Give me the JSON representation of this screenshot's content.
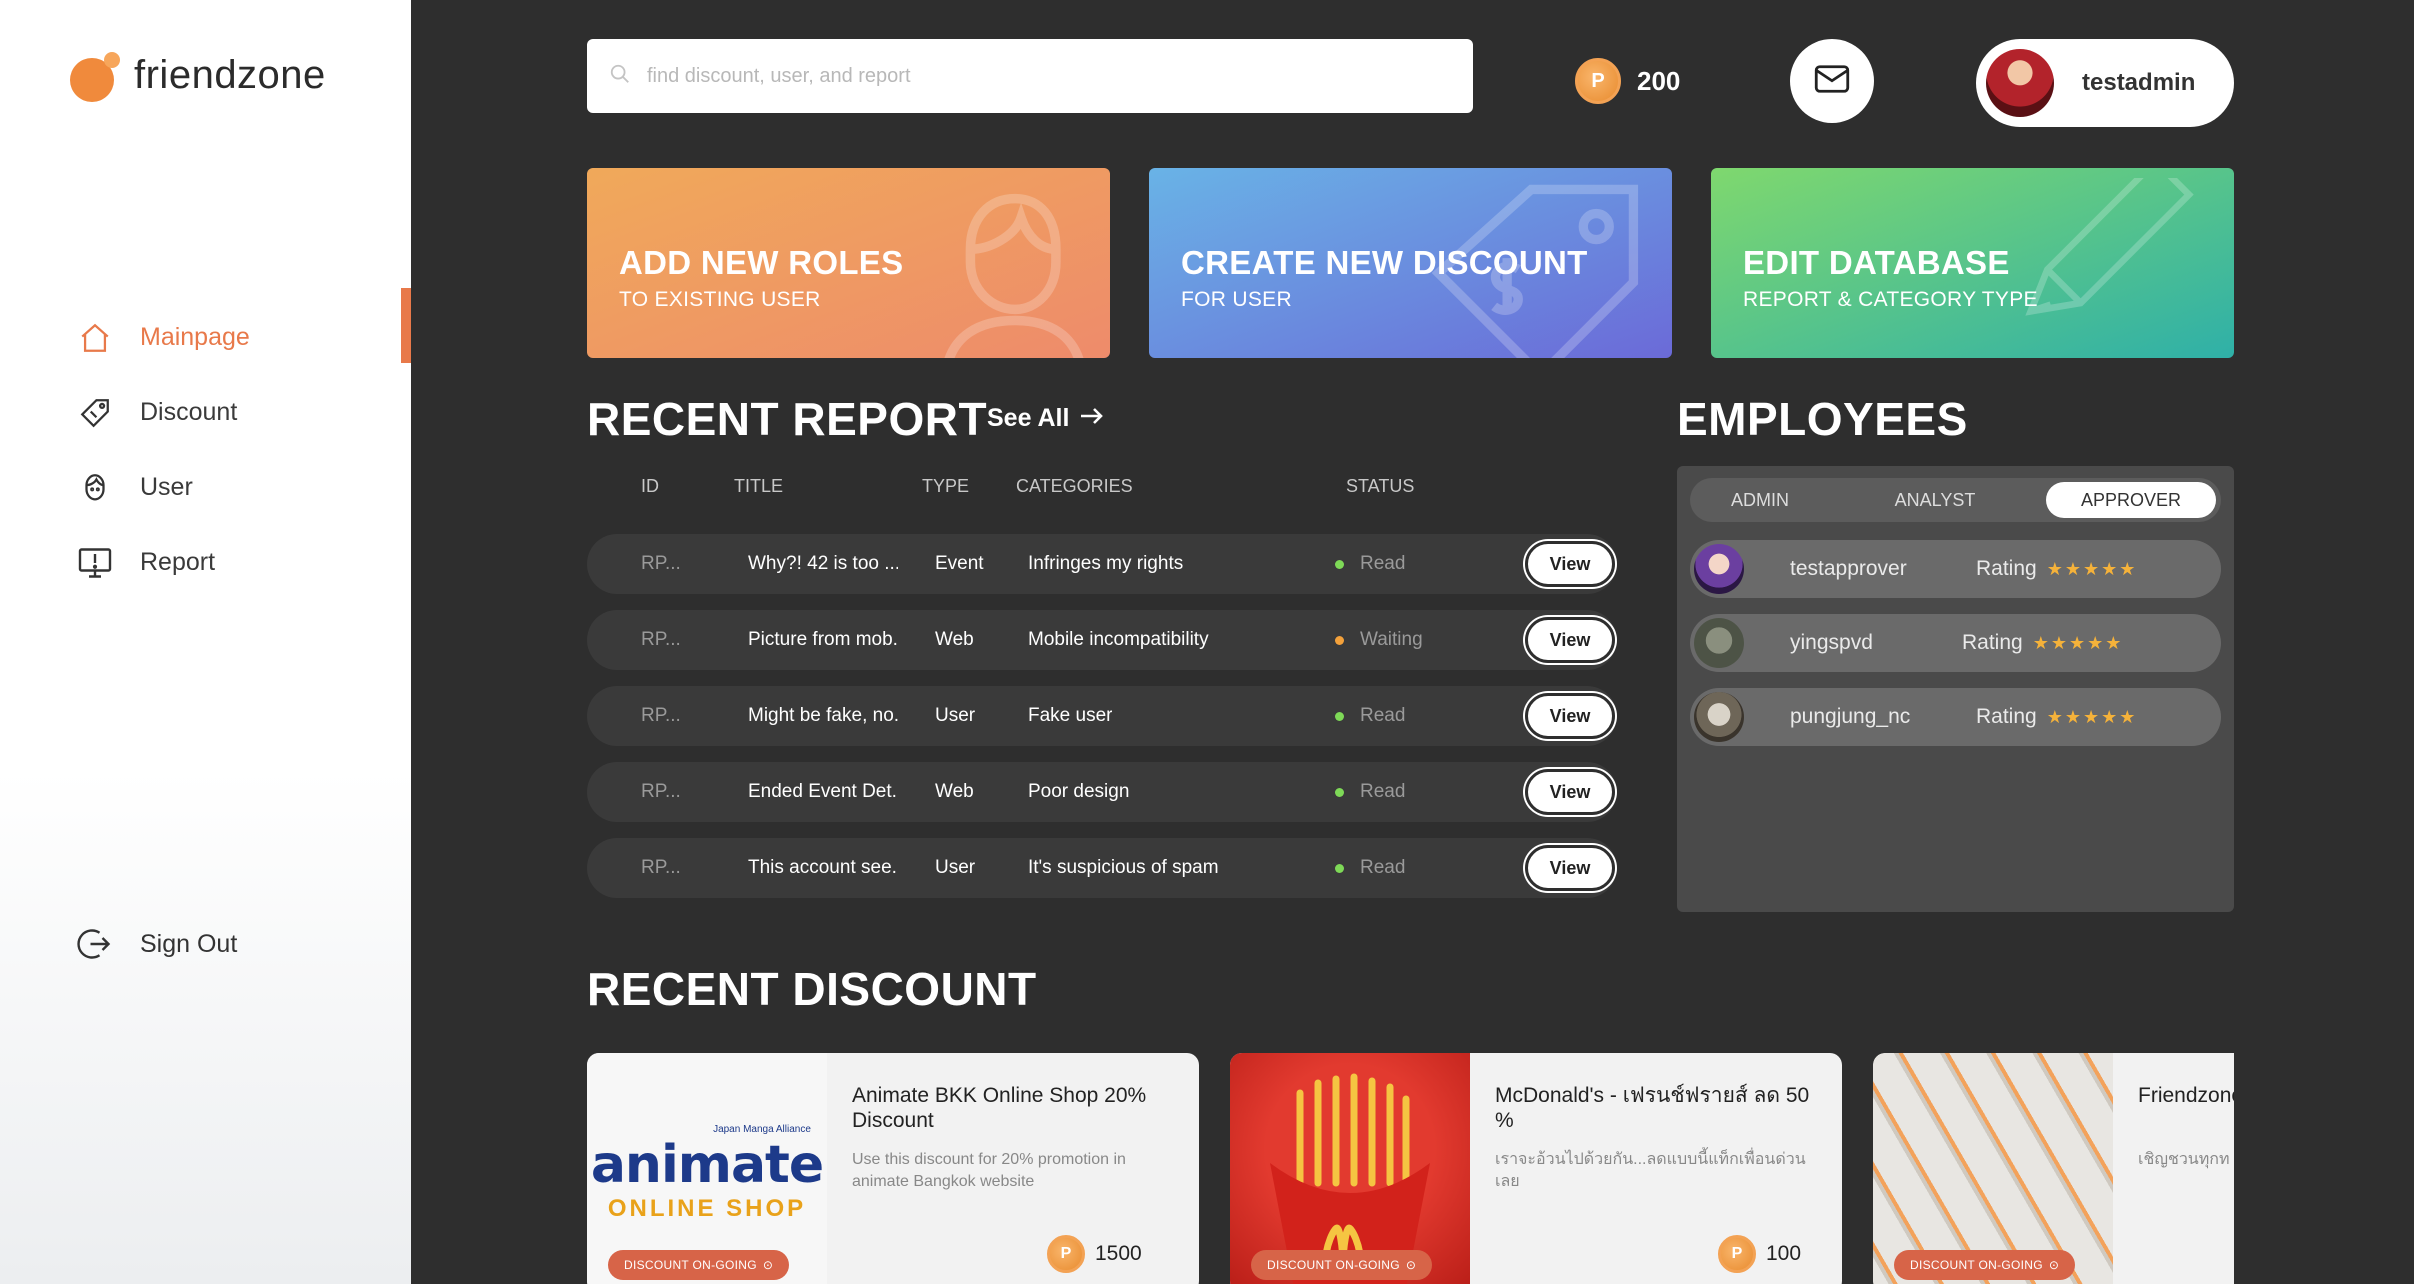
{
  "app": {
    "name": "friendzone"
  },
  "nav": {
    "items": [
      {
        "label": "Mainpage",
        "icon": "home-icon",
        "active": true
      },
      {
        "label": "Discount",
        "icon": "tag-icon",
        "active": false
      },
      {
        "label": "User",
        "icon": "user-icon",
        "active": false
      },
      {
        "label": "Report",
        "icon": "report-icon",
        "active": false
      }
    ],
    "sign_out": "Sign Out"
  },
  "search": {
    "placeholder": "find discount, user, and report"
  },
  "header": {
    "points": "200",
    "username": "testadmin"
  },
  "actions": [
    {
      "title": "ADD NEW ROLES",
      "subtitle": "TO EXISTING USER"
    },
    {
      "title": "CREATE NEW DISCOUNT",
      "subtitle": "FOR USER"
    },
    {
      "title": "EDIT DATABASE",
      "subtitle": "REPORT & CATEGORY TYPE"
    }
  ],
  "reports": {
    "title": "RECENT REPORT",
    "see_all": "See All",
    "columns": {
      "id": "ID",
      "title": "TITLE",
      "type": "TYPE",
      "categories": "CATEGORIES",
      "status": "STATUS"
    },
    "view_label": "View",
    "rows": [
      {
        "id": "RP...",
        "title": "Why?! 42 is too ...",
        "type": "Event",
        "category": "Infringes my rights",
        "status": "Read"
      },
      {
        "id": "RP...",
        "title": "Picture from mob...",
        "type": "Web",
        "category": "Mobile incompatibility",
        "status": "Waiting"
      },
      {
        "id": "RP...",
        "title": "Might be fake, no...",
        "type": "User",
        "category": "Fake user",
        "status": "Read"
      },
      {
        "id": "RP...",
        "title": "Ended Event Det...",
        "type": "Web",
        "category": "Poor design",
        "status": "Read"
      },
      {
        "id": "RP...",
        "title": "This account see...",
        "type": "User",
        "category": "It's suspicious of spam",
        "status": "Read"
      }
    ]
  },
  "employees": {
    "title": "EMPLOYEES",
    "tabs": [
      "ADMIN",
      "ANALYST",
      "APPROVER"
    ],
    "active_tab": "APPROVER",
    "rating_label": "Rating",
    "rows": [
      {
        "name": "testapprover",
        "rating": 5
      },
      {
        "name": "yingspvd",
        "rating": 5
      },
      {
        "name": "pungjung_nc",
        "rating": 5
      }
    ]
  },
  "discounts": {
    "title": "RECENT DISCOUNT",
    "badge": "DISCOUNT ON-GOING",
    "items": [
      {
        "title": "Animate BKK Online Shop 20% Discount",
        "desc": "Use this discount for 20% promotion in animate Bangkok website",
        "price": "1500",
        "logo_main": "animate",
        "logo_sub": "ONLINE SHOP",
        "logo_top": "Japan Manga Alliance"
      },
      {
        "title": "McDonald's - เฟรนช์ฟรายส์ ลด 50 %",
        "desc": "เราจะอ้วนไปด้วยกัน...ลดแบบนี้แท็กเพื่อนด่วนเลย",
        "price": "100"
      },
      {
        "title": "Friendzone เข้างานเปิด",
        "desc": "เชิญชวนทุกท Friendzone"
      }
    ]
  },
  "colors": {
    "accent": "#e8794a",
    "background": "#2e2e2e",
    "read": "#7ed957",
    "waiting": "#f3a13b",
    "star": "#f5b23a"
  }
}
